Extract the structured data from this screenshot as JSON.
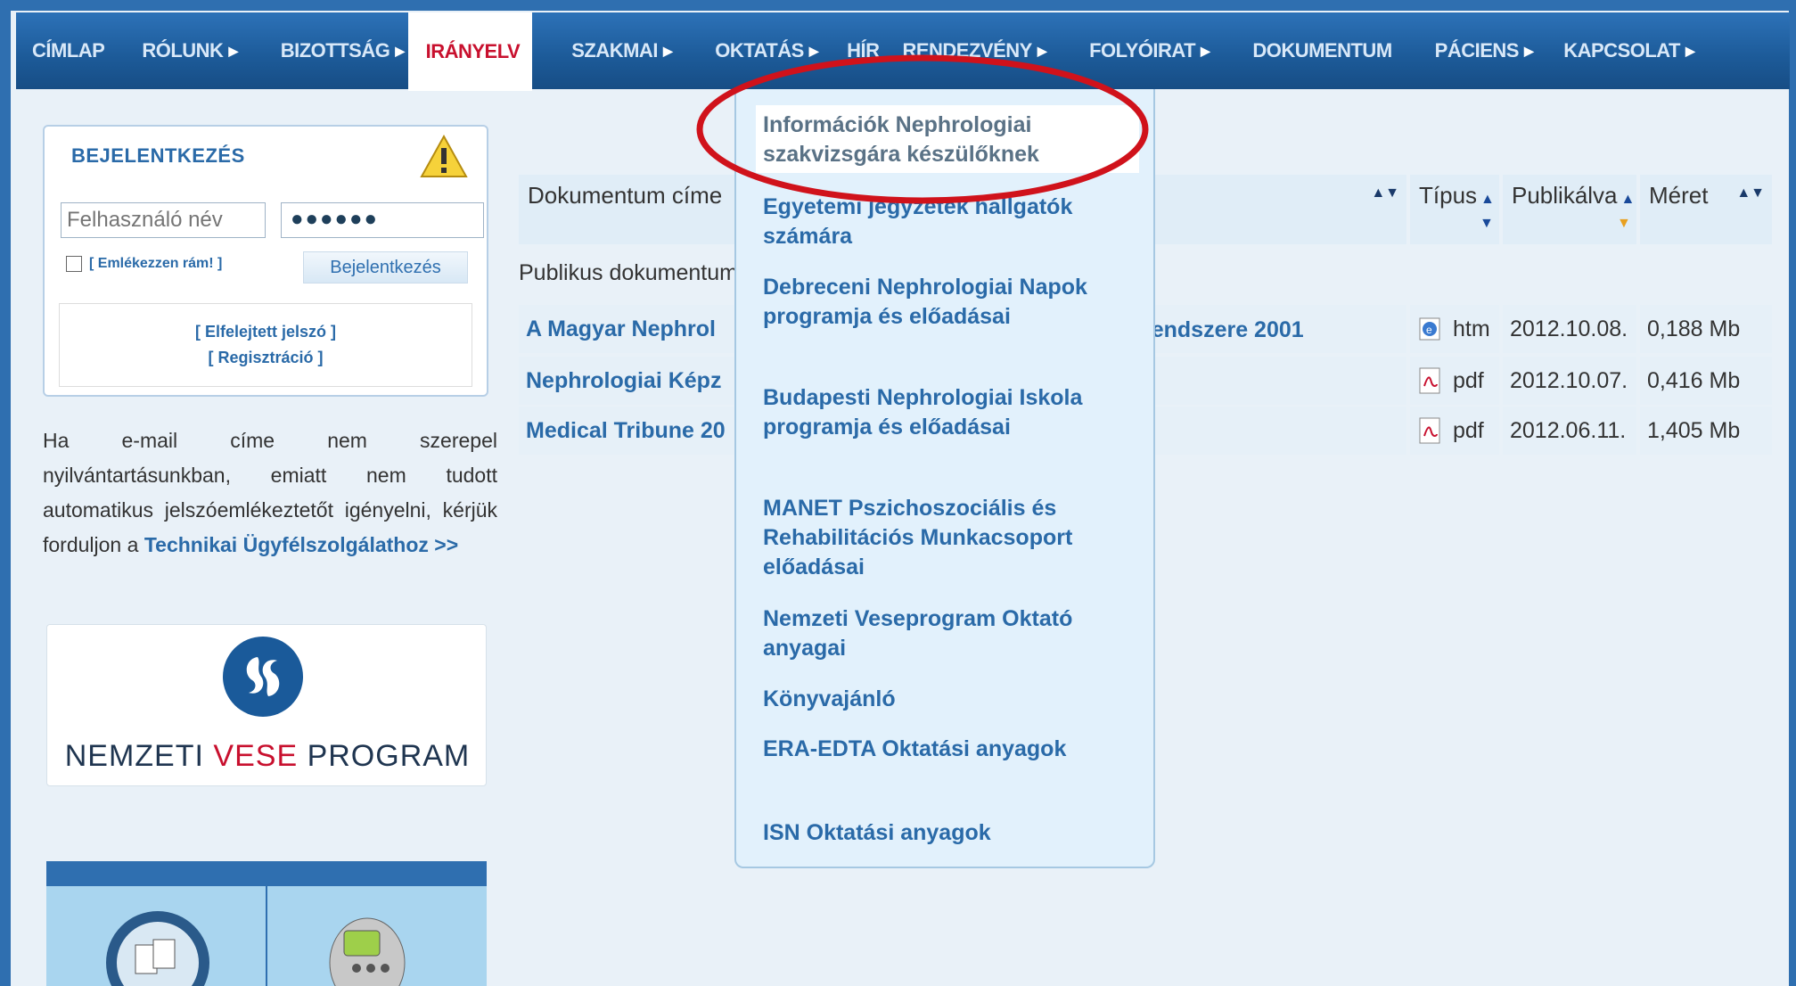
{
  "nav": {
    "items": [
      {
        "label": "CÍMLAP",
        "arrow": false,
        "active": false
      },
      {
        "label": "RÓLUNK",
        "arrow": true,
        "active": false
      },
      {
        "label": "BIZOTTSÁG",
        "arrow": true,
        "active": false
      },
      {
        "label": "IRÁNYELV",
        "arrow": false,
        "active": true
      },
      {
        "label": "SZAKMAI",
        "arrow": true,
        "active": false
      },
      {
        "label": "OKTATÁS",
        "arrow": true,
        "active": false
      },
      {
        "label": "HÍR",
        "arrow": false,
        "active": false
      },
      {
        "label": "RENDEZVÉNY",
        "arrow": true,
        "active": false
      },
      {
        "label": "FOLYÓIRAT",
        "arrow": true,
        "active": false
      },
      {
        "label": "DOKUMENTUM",
        "arrow": false,
        "active": false
      },
      {
        "label": "PÁCIENS",
        "arrow": true,
        "active": false
      },
      {
        "label": "KAPCSOLAT",
        "arrow": true,
        "active": false
      }
    ],
    "arrow_glyph": "▶"
  },
  "login": {
    "title": "BEJELENTKEZÉS",
    "username_placeholder": "Felhasználó név",
    "password_value": "●●●●●●",
    "remember_label": "[ Emlékezzen rám! ]",
    "submit_label": "Bejelentkezés",
    "forgot_label": "[ Elfelejtett jelszó ]",
    "register_label": "[ Regisztráció ]"
  },
  "info": {
    "text": "Ha e-mail címe nem szerepel nyilvántartásunkban, emiatt nem tudott automatikus jelszóemlékeztetőt igényelni, kérjük forduljon a ",
    "link_text": "Technikai Ügyfélszolgálathoz >>"
  },
  "vese": {
    "word1": "NEMZETI ",
    "word2": "VESE",
    "word3": " PROGRAM"
  },
  "table": {
    "headers": {
      "title": "Dokumentum címe",
      "type": "Típus",
      "published": "Publikálva",
      "size": "Méret"
    },
    "sort_up": "▲",
    "sort_down": "▼",
    "sort_both": "▲▼",
    "public_label": "Publikus dokumentum",
    "rows": [
      {
        "title": "A Magyar Nephrol",
        "title_tail": "rendszere 2001",
        "type": "htm",
        "published": "2012.10.08.",
        "size": "0,188 Mb",
        "icon": "ie-icon"
      },
      {
        "title": "Nephrologiai Képz",
        "title_tail": "",
        "type": "pdf",
        "published": "2012.10.07.",
        "size": "0,416 Mb",
        "icon": "pdf-icon"
      },
      {
        "title": "Medical Tribune 20",
        "title_tail": "",
        "type": "pdf",
        "published": "2012.06.11.",
        "size": "1,405 Mb",
        "icon": "pdf-icon"
      }
    ]
  },
  "dropdown": {
    "items": [
      "Információk Nephrologiai szakvizsgára készülőknek",
      "Egyetemi jegyzetek hallgatók számára",
      "Debreceni Nephrologiai Napok programja és előadásai",
      "Budapesti Nephrologiai Iskola programja és előadásai",
      "MANET Pszichoszociális és Rehabilitációs Munkacsoport előadásai",
      "Nemzeti Veseprogram Oktató anyagai",
      "Könyvajánló",
      "ERA-EDTA Oktatási anyagok",
      "ISN Oktatási anyagok"
    ]
  },
  "colors": {
    "nav_bg": "#1c5a98",
    "active_text": "#c8102e",
    "link": "#2a6aa8",
    "highlight_oval": "#d0121b"
  }
}
